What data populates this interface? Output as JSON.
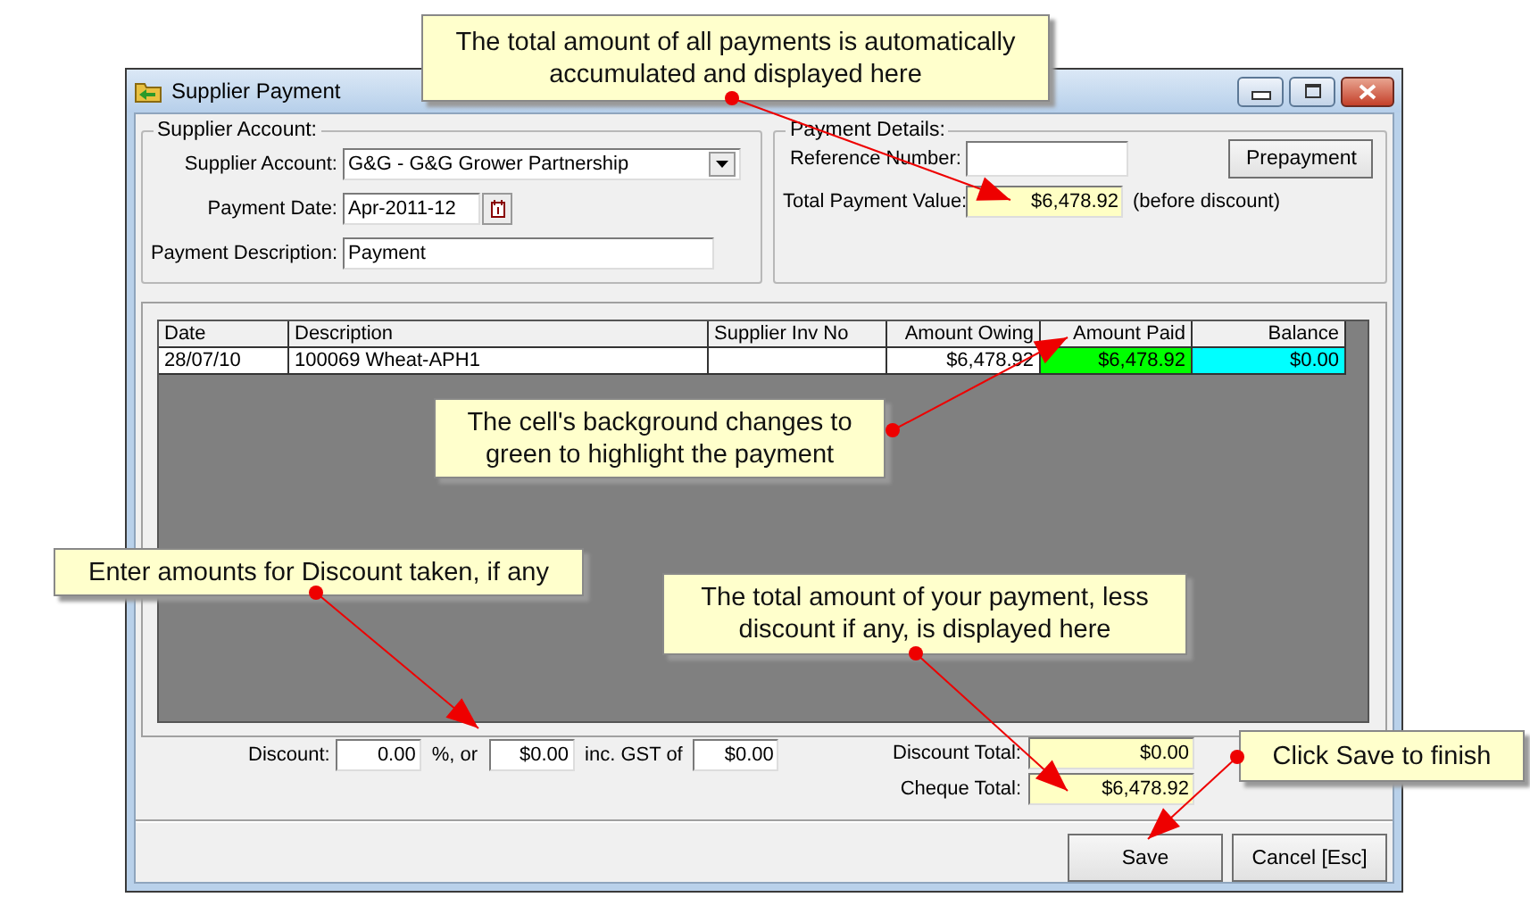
{
  "window": {
    "title": "Supplier Payment"
  },
  "supplier_account": {
    "legend": "Supplier Account:",
    "fields": [
      {
        "kind": "dropdown",
        "label": "Supplier Account:",
        "value": "G&G - G&G Grower Partnership"
      },
      {
        "kind": "date",
        "label": "Payment Date:",
        "value": "Apr-2011-12"
      },
      {
        "kind": "text",
        "label": "Payment Description:",
        "value": "Payment"
      }
    ]
  },
  "payment_details": {
    "legend": "Payment Details:",
    "reference_label": "Reference Number:",
    "total_label": "Total Payment Value:",
    "total_value": "$6,478.92",
    "total_note": "(before discount)",
    "button": "Prepayment"
  },
  "table": {
    "columns": [
      "Date",
      "Description",
      "Supplier Inv No",
      "Amount Owing",
      "Amount Paid",
      "Balance"
    ],
    "rows": [
      {
        "cells": [
          {
            "text": "28/07/10"
          },
          {
            "text": "100069 Wheat-APH1"
          },
          {
            "text": ""
          },
          {
            "text": "$6,478.92"
          },
          {
            "text": "$6,478.92",
            "color": "#00ff00"
          },
          {
            "text": "$0.00",
            "color": "#00ffff"
          }
        ]
      }
    ]
  },
  "discount": {
    "label": "Discount:",
    "percent": "0.00",
    "percent_suffix": "%, or",
    "amount": "$0.00",
    "gst_label": "inc. GST of",
    "gst": "$0.00"
  },
  "totals": [
    {
      "label": "Discount Total:",
      "value": "$0.00"
    },
    {
      "label": "Cheque Total:",
      "value": "$6,478.92"
    }
  ],
  "buttons": [
    "Save",
    "Cancel [Esc]"
  ],
  "callouts": [
    {
      "text": "The total amount of all payments is automatically accumulated and displayed here"
    },
    {
      "text": "The cell's background changes to green to highlight the payment"
    },
    {
      "text": "Enter amounts for Discount taken, if any"
    },
    {
      "text": "The total amount of your payment, less discount if any, is displayed here"
    },
    {
      "text": "Click Save to finish"
    }
  ]
}
